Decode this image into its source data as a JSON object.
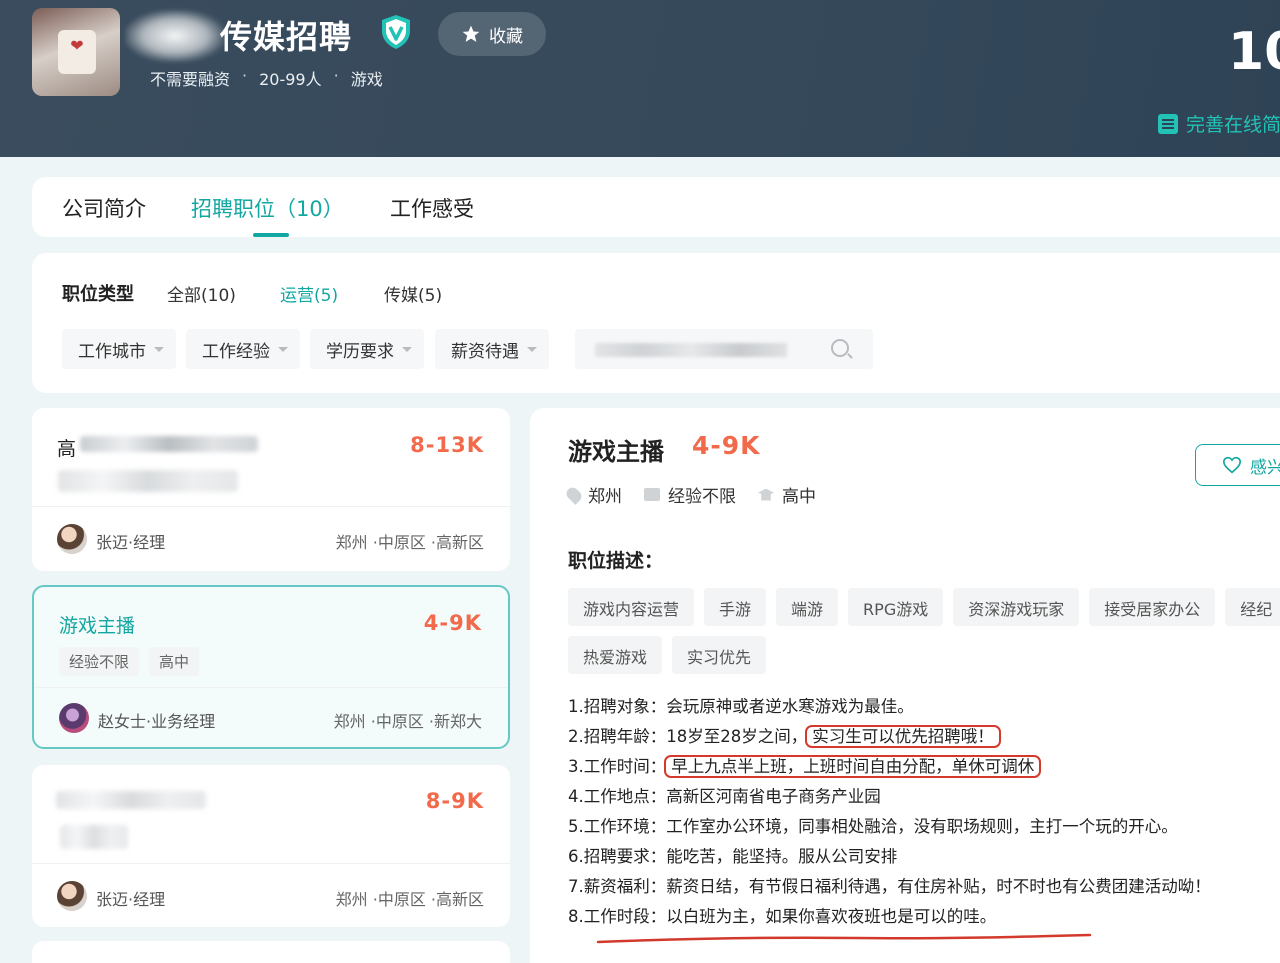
{
  "company": {
    "name": "传媒招聘",
    "meta": [
      "不需要融资",
      "20-99人",
      "游戏"
    ],
    "fav_label": "收藏",
    "count_label": "10",
    "perfect_label": "完善在线简"
  },
  "tabs": [
    "公司简介",
    "招聘职位（10）",
    "工作感受"
  ],
  "filters": {
    "type_label": "职位类型",
    "types": [
      "全部(10)",
      "运营(5)",
      "传媒(5)"
    ],
    "dropdowns": [
      "工作城市",
      "工作经验",
      "学历要求",
      "薪资待遇"
    ]
  },
  "jobs": [
    {
      "title": "高",
      "salary": "8-13K",
      "tags": [],
      "person": "张迈·经理",
      "location": "郑州 ·中原区 ·高新区"
    },
    {
      "title": "游戏主播",
      "salary": "4-9K",
      "tags": [
        "经验不限",
        "高中"
      ],
      "person": "赵女士·业务经理",
      "location": "郑州 ·中原区 ·新郑大"
    },
    {
      "title": "",
      "salary": "8-9K",
      "tags": [],
      "person": "张迈·经理",
      "location": "郑州 ·中原区 ·高新区"
    }
  ],
  "detail": {
    "title": "游戏主播",
    "salary": "4-9K",
    "interest_label": "感兴",
    "city": "郑州",
    "experience": "经验不限",
    "education": "高中",
    "section_label": "职位描述：",
    "tags": [
      "游戏内容运营",
      "手游",
      "端游",
      "RPG游戏",
      "资深游戏玩家",
      "接受居家办公",
      "经纪",
      "热爱游戏",
      "实习优先"
    ],
    "lines": [
      "1.招聘对象：会玩原神或者逆水寒游戏为最佳。",
      "2.招聘年龄：18岁至28岁之间，",
      "实习生可以优先招聘哦！",
      "3.工作时间：",
      "早上九点半上班，上班时间自由分配，单休可调休",
      "4.工作地点：高新区河南省电子商务产业园",
      "5.工作环境：工作室办公环境，同事相处融洽，没有职场规则，主打一个玩的开心。",
      "6.招聘要求：能吃苦，能坚持。服从公司安排",
      "7.薪资福利：薪资日结，有节假日福利待遇，有住房补贴，时不时也有公费团建活动呦！",
      "8.工作时段：以白班为主，如果你喜欢夜班也是可以的哇。"
    ]
  },
  "colors": {
    "accent": "#13a7a2",
    "salary": "#f26a4b",
    "header": "#35495b",
    "highlight": "#d33a2c"
  }
}
